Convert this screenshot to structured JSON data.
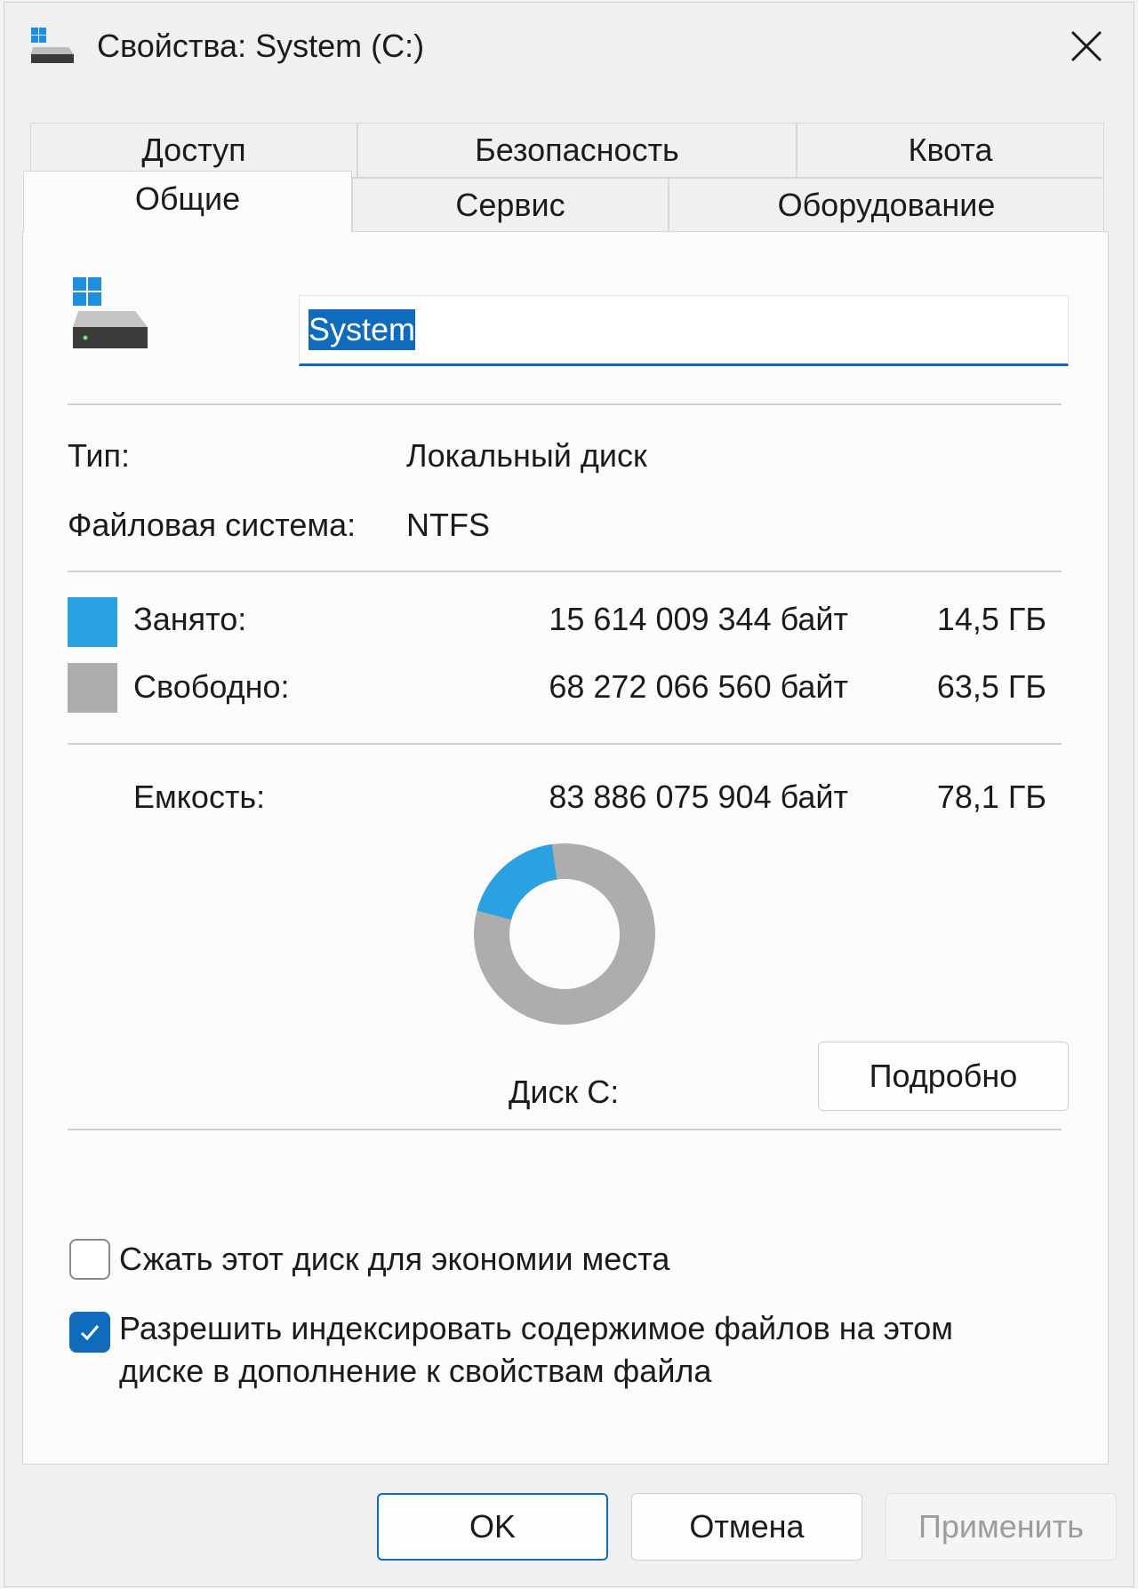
{
  "window": {
    "title": "Свойства: System (C:)",
    "icons": {
      "title": "drive-icon",
      "close": "close-icon"
    }
  },
  "tabs": {
    "row_back": [
      "Доступ",
      "Безопасность",
      "Квота"
    ],
    "row_front": [
      "Общие",
      "Сервис",
      "Оборудование"
    ],
    "active": "Общие"
  },
  "general": {
    "volume_name": "System",
    "type_label": "Тип:",
    "type_value": "Локальный диск",
    "fs_label": "Файловая система:",
    "fs_value": "NTFS",
    "used": {
      "label": "Занято:",
      "bytes": "15 614 009 344 байт",
      "size": "14,5 ГБ",
      "color": "#2aa1e0"
    },
    "free": {
      "label": "Свободно:",
      "bytes": "68 272 066 560 байт",
      "size": "63,5 ГБ",
      "color": "#adadad"
    },
    "capacity": {
      "label": "Емкость:",
      "bytes": "83 886 075 904 байт",
      "size": "78,1 ГБ"
    },
    "used_fraction": 0.186,
    "disk_label": "Диск C:",
    "details_button": "Подробно",
    "compress_label": "Сжать этот диск для экономии места",
    "compress_checked": false,
    "index_label_line1": "Разрешить индексировать содержимое файлов на этом",
    "index_label_line2": "диске в дополнение к свойствам файла",
    "index_checked": true
  },
  "footer": {
    "ok": "OK",
    "cancel": "Отмена",
    "apply": "Применить"
  }
}
